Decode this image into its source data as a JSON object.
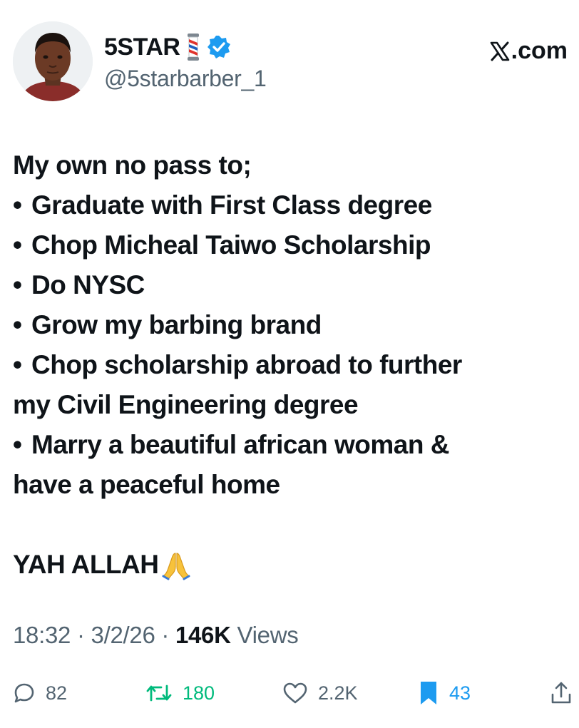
{
  "header": {
    "display_name": "5STAR",
    "handle": "@5starbarber_1",
    "brand": ".com",
    "icons": {
      "avatar": "profile-photo",
      "name_emoji": "barber-pole-icon",
      "verified": "verified-badge-icon",
      "brand_logo": "x-logo-icon"
    }
  },
  "tweet": {
    "intro": "My own no pass to;",
    "bullet_char": "•",
    "items": [
      "Graduate with First Class degree",
      "Chop Micheal Taiwo Scholarship",
      "Do NYSC",
      "Grow my barbing brand",
      "Chop scholarship abroad to further",
      "Marry a beautiful african woman &"
    ],
    "continuations": [
      "my Civil Engineering degree",
      "have a peaceful home"
    ],
    "closing": "YAH ALLAH",
    "closing_emoji": "pray-icon"
  },
  "meta": {
    "time": "18:32",
    "separator": "·",
    "date": "3/2/26",
    "views_count": "146K",
    "views_label": "Views"
  },
  "actions": {
    "replies": "82",
    "retweets": "180",
    "likes": "2.2K",
    "bookmarks": "43"
  },
  "colors": {
    "text": "#0f1419",
    "secondary": "#536471",
    "verified": "#1d9bf0",
    "retweet_active": "#00ba7c",
    "bookmark_active": "#1d9bf0"
  }
}
